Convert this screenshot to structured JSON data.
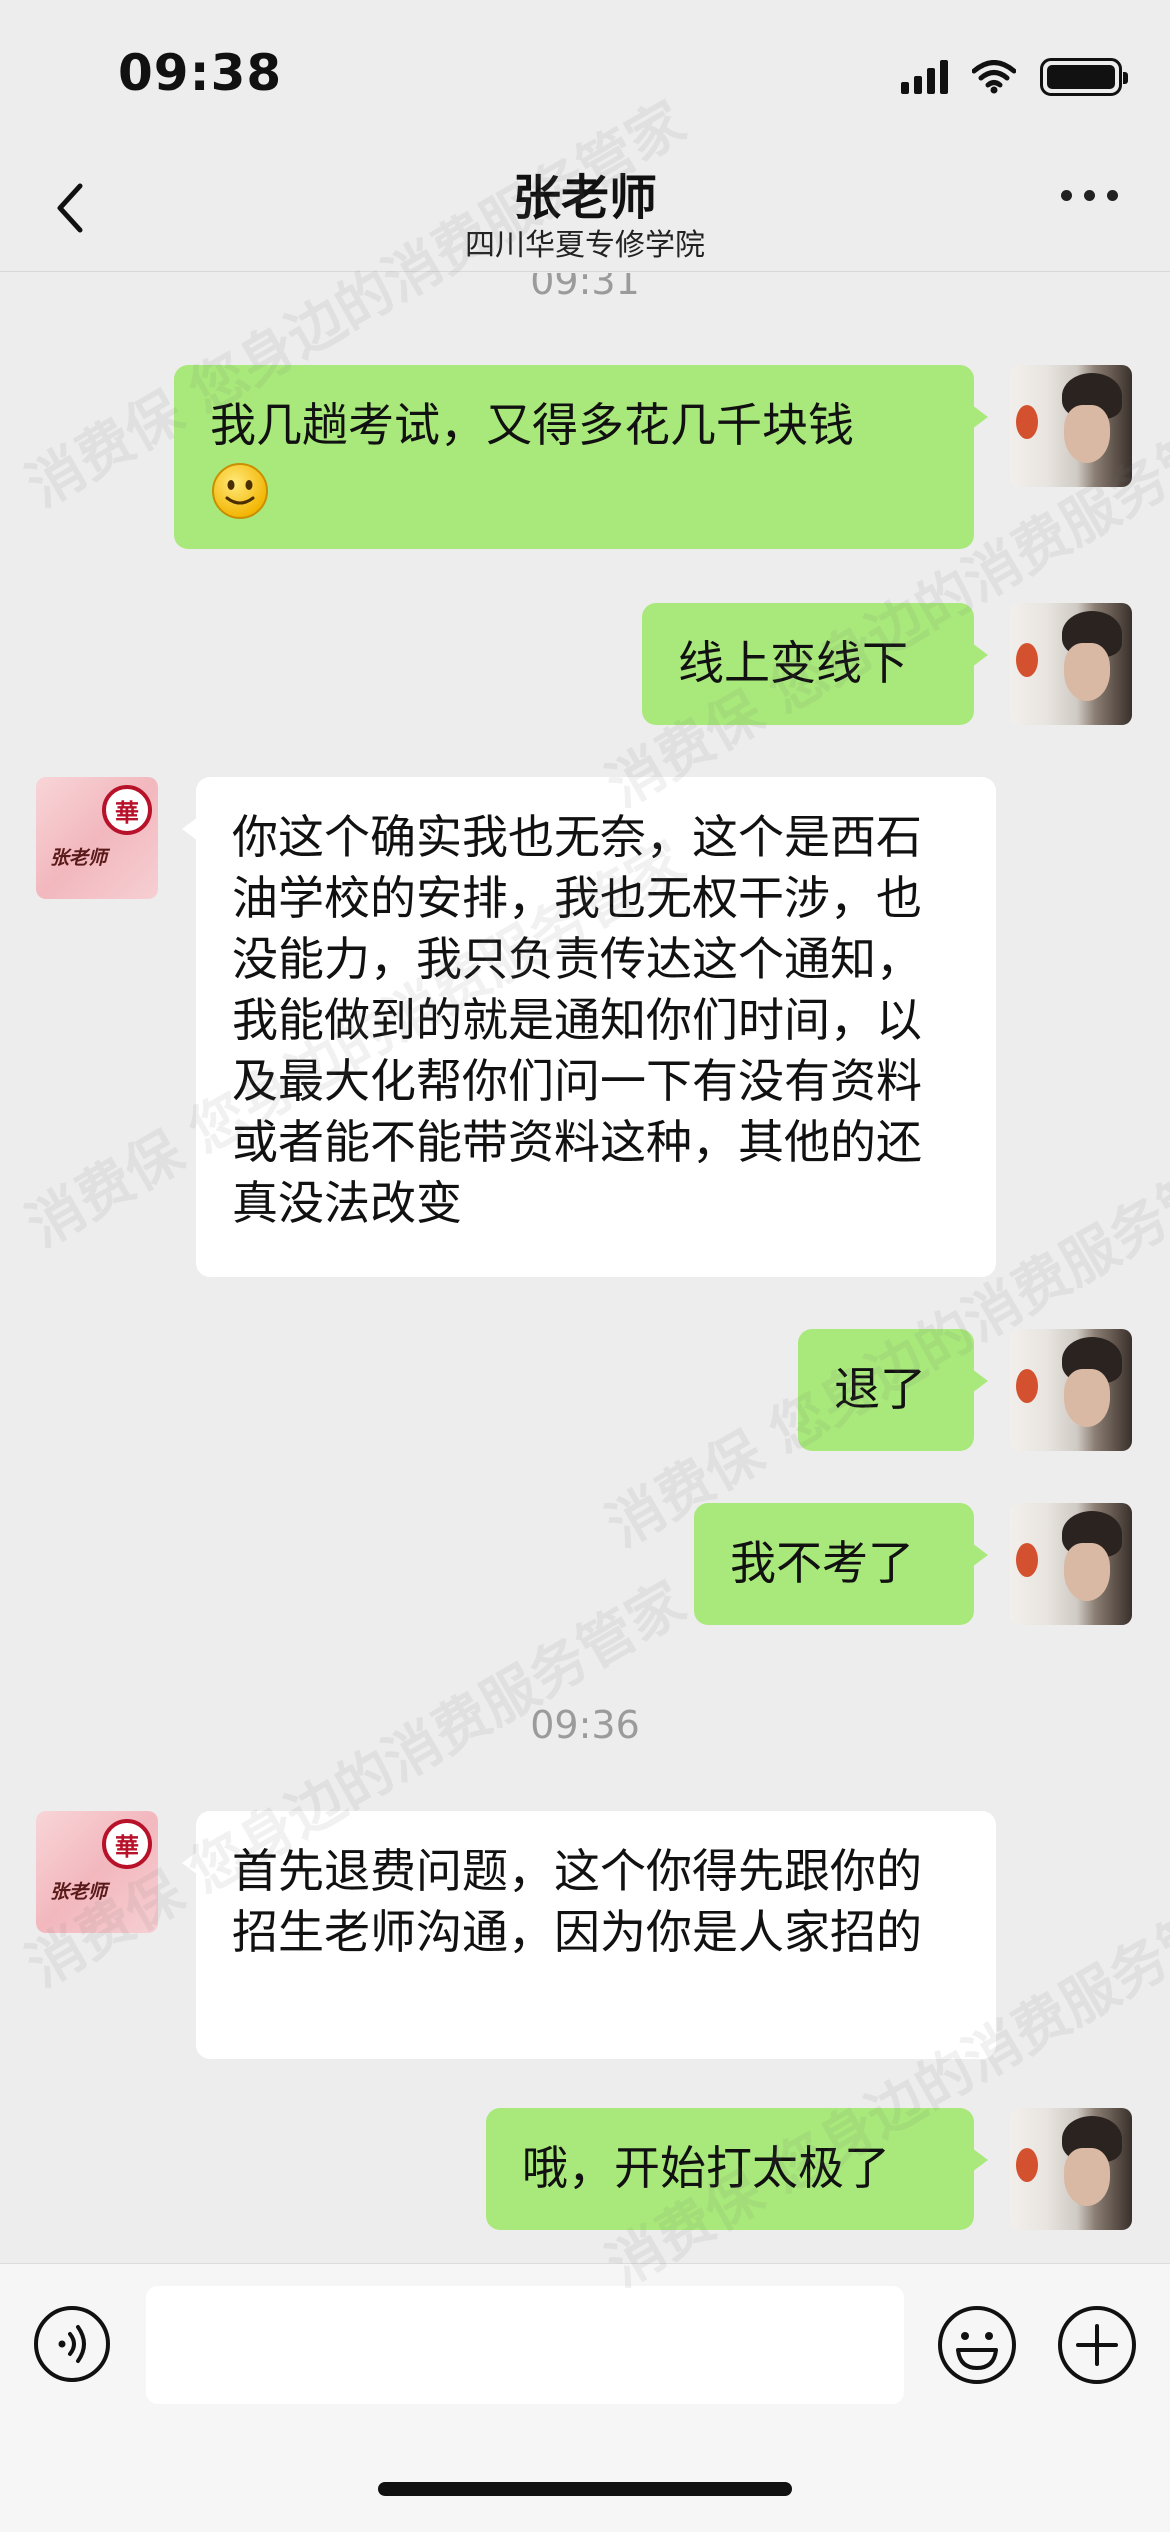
{
  "status_bar": {
    "time": "09:38"
  },
  "header": {
    "title": "张老师",
    "subtitle": "四川华夏专修学院"
  },
  "avatars": {
    "teacher_text": "张老师",
    "teacher_seal": "華"
  },
  "timestamps": [
    "09:31",
    "09:36"
  ],
  "messages": [
    {
      "sender": "me",
      "text": "我几趟考试，又得多花几千块钱",
      "emoji": "slightly-smiling-face-icon"
    },
    {
      "sender": "me",
      "text": "线上变线下"
    },
    {
      "sender": "them",
      "text": "你这个确实我也无奈，这个是西石油学校的安排，我也无权干涉，也没能力，我只负责传达这个通知，我能做到的就是通知你们时间，以及最大化帮你们问一下有没有资料或者能不能带资料这种，其他的还真没法改变"
    },
    {
      "sender": "me",
      "text": "退了"
    },
    {
      "sender": "me",
      "text": "我不考了"
    },
    {
      "sender": "them",
      "text": "首先退费问题，这个你得先跟你的招生老师沟通，因为你是人家招的"
    },
    {
      "sender": "me",
      "text": "哦，开始打太极了"
    }
  ],
  "input_bar": {
    "placeholder": ""
  },
  "watermark": {
    "text": "消费保 您身边的消费服务管家"
  },
  "colors": {
    "my_bubble": "#a9e97b",
    "their_bubble": "#ffffff",
    "background": "#ededed"
  },
  "icons": {
    "back": "chevron-left-icon",
    "more": "more-dots-icon",
    "voice": "voice-icon",
    "emoji": "emoji-icon",
    "plus": "plus-icon"
  }
}
